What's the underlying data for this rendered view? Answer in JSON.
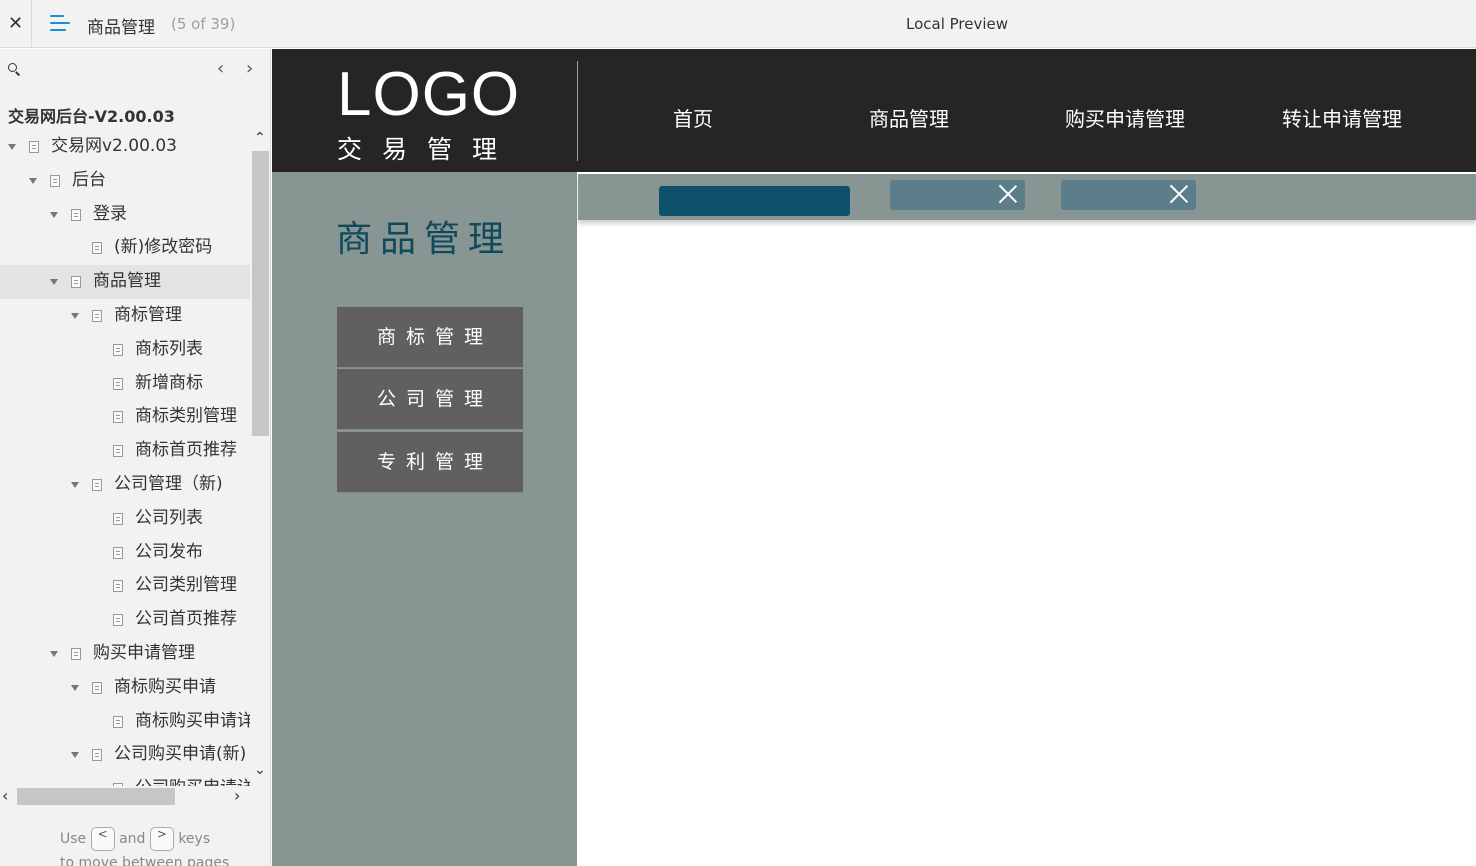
{
  "topbar": {
    "close_glyph": "✕",
    "page_title": "商品管理",
    "page_count": "(5 of 39)",
    "preview_label": "Local Preview"
  },
  "sidebar": {
    "prev_glyph": "‹",
    "next_glyph": "›",
    "project_title": "交易网后台-V2.00.03",
    "tree": [
      {
        "label": "交易网v2.00.03",
        "level": 0,
        "caret": true
      },
      {
        "label": "后台",
        "level": 1,
        "caret": true
      },
      {
        "label": "登录",
        "level": 2,
        "caret": true
      },
      {
        "label": "(新)修改密码",
        "level": 3,
        "caret": false
      },
      {
        "label": "商品管理",
        "level": 2,
        "caret": true,
        "active": true
      },
      {
        "label": "商标管理",
        "level": 3,
        "caret": true
      },
      {
        "label": "商标列表",
        "level": 4,
        "caret": false
      },
      {
        "label": "新增商标",
        "level": 4,
        "caret": false
      },
      {
        "label": "商标类别管理",
        "level": 4,
        "caret": false
      },
      {
        "label": "商标首页推荐",
        "level": 4,
        "caret": false
      },
      {
        "label": "公司管理（新)",
        "level": 3,
        "caret": true
      },
      {
        "label": "公司列表",
        "level": 4,
        "caret": false
      },
      {
        "label": "公司发布",
        "level": 4,
        "caret": false
      },
      {
        "label": "公司类别管理",
        "level": 4,
        "caret": false
      },
      {
        "label": "公司首页推荐",
        "level": 4,
        "caret": false
      },
      {
        "label": "购买申请管理",
        "level": 2,
        "caret": true
      },
      {
        "label": "商标购买申请",
        "level": 3,
        "caret": true
      },
      {
        "label": "商标购买申请详",
        "level": 4,
        "caret": false
      },
      {
        "label": "公司购买申请(新)",
        "level": 3,
        "caret": true
      },
      {
        "label": "公司购买申请详",
        "level": 4,
        "caret": false
      }
    ],
    "hint_use": "Use",
    "hint_key_prev": "<",
    "hint_and": "and",
    "hint_key_next": ">",
    "hint_keys": "keys",
    "hint_line2": "to move between pages"
  },
  "preview": {
    "logo": "LOGO",
    "logo_sub": "交易管理",
    "nav": [
      "首页",
      "商品管理",
      "购买申请管理",
      "转让申请管理"
    ],
    "panel_title": "商品管理",
    "menu": [
      "商标管理",
      "公司管理",
      "专利管理"
    ],
    "colors": {
      "header_bg": "#272424",
      "panel_bg": "#889693",
      "panel_title": "#0e4a5c",
      "menu_bg": "#625f61",
      "tab_active": "#0e4f6c",
      "tab": "#5c7e8a",
      "accent_icon": "#1a8fd6"
    }
  }
}
